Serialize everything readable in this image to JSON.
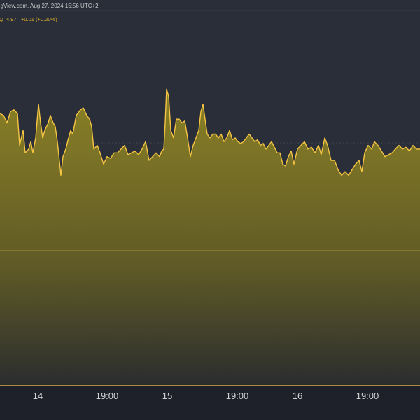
{
  "header": {
    "attribution": "ngView.com, Aug 27, 2024 15:56 UTC+2",
    "symbol_suffix": "Q",
    "last_price": "4.97",
    "change": "+0.01 (+0.20%)"
  },
  "colors": {
    "background": "#2a2e39",
    "axis_band": "#1e212a",
    "line": "#f5c542",
    "fill_top": "#8b8126",
    "fill_bottom": "#2b2d2e",
    "grid": "#41444f",
    "baseline": "#b9a53a"
  },
  "chart_data": {
    "type": "area",
    "title": "",
    "xlabel": "",
    "ylabel": "",
    "x_tick_labels": [
      "14",
      "19:00",
      "15",
      "19:00",
      "16",
      "19:00"
    ],
    "x_range": [
      0,
      600
    ],
    "y_range": [
      0,
      100
    ],
    "grid": true,
    "series": [
      {
        "values": [
          [
            0,
            72.5
          ],
          [
            5,
            72
          ],
          [
            10,
            70
          ],
          [
            15,
            73
          ],
          [
            20,
            73.5
          ],
          [
            25,
            72.5
          ],
          [
            28,
            64
          ],
          [
            33,
            68
          ],
          [
            36,
            62
          ],
          [
            41,
            63
          ],
          [
            44,
            65
          ],
          [
            47,
            62
          ],
          [
            51,
            66
          ],
          [
            55,
            75
          ],
          [
            58,
            70
          ],
          [
            61,
            66
          ],
          [
            64,
            68
          ],
          [
            69,
            70
          ],
          [
            72,
            72
          ],
          [
            76,
            70
          ],
          [
            79,
            69
          ],
          [
            82,
            65
          ],
          [
            87,
            56
          ],
          [
            90,
            61
          ],
          [
            94,
            63
          ],
          [
            98,
            66
          ],
          [
            101,
            68
          ],
          [
            104,
            67
          ],
          [
            109,
            72
          ],
          [
            115,
            73.5
          ],
          [
            119,
            74
          ],
          [
            124,
            72
          ],
          [
            128,
            71
          ],
          [
            131,
            69
          ],
          [
            134,
            63
          ],
          [
            139,
            64
          ],
          [
            143,
            62
          ],
          [
            148,
            59
          ],
          [
            153,
            61
          ],
          [
            158,
            60.5
          ],
          [
            163,
            62
          ],
          [
            168,
            62
          ],
          [
            173,
            63
          ],
          [
            178,
            64
          ],
          [
            183,
            61.5
          ],
          [
            188,
            62
          ],
          [
            193,
            62.5
          ],
          [
            198,
            61.5
          ],
          [
            203,
            63
          ],
          [
            208,
            65
          ],
          [
            213,
            60
          ],
          [
            218,
            61
          ],
          [
            223,
            62
          ],
          [
            228,
            61
          ],
          [
            231,
            62.5
          ],
          [
            234,
            63
          ],
          [
            236,
            70
          ],
          [
            238,
            79
          ],
          [
            241,
            77
          ],
          [
            244,
            68
          ],
          [
            248,
            66
          ],
          [
            252,
            71
          ],
          [
            256,
            71
          ],
          [
            260,
            70
          ],
          [
            264,
            70.5
          ],
          [
            268,
            66
          ],
          [
            272,
            61
          ],
          [
            276,
            64
          ],
          [
            280,
            66
          ],
          [
            284,
            68
          ],
          [
            287,
            73
          ],
          [
            290,
            75
          ],
          [
            293,
            71
          ],
          [
            296,
            67
          ],
          [
            300,
            66
          ],
          [
            304,
            67
          ],
          [
            308,
            67
          ],
          [
            312,
            66
          ],
          [
            316,
            67
          ],
          [
            320,
            65
          ],
          [
            324,
            66
          ],
          [
            328,
            68
          ],
          [
            332,
            65.5
          ],
          [
            336,
            66
          ],
          [
            340,
            65
          ],
          [
            344,
            64.5
          ],
          [
            348,
            65
          ],
          [
            352,
            66
          ],
          [
            356,
            67
          ],
          [
            360,
            66
          ],
          [
            364,
            65
          ],
          [
            368,
            65.5
          ],
          [
            372,
            64
          ],
          [
            376,
            64.5
          ],
          [
            380,
            63
          ],
          [
            384,
            64
          ],
          [
            388,
            65
          ],
          [
            392,
            63.5
          ],
          [
            396,
            62
          ],
          [
            400,
            62
          ],
          [
            404,
            59
          ],
          [
            408,
            58.5
          ],
          [
            412,
            61
          ],
          [
            416,
            62.5
          ],
          [
            420,
            59
          ],
          [
            425,
            63
          ],
          [
            430,
            64
          ],
          [
            435,
            65
          ],
          [
            440,
            63
          ],
          [
            445,
            63.5
          ],
          [
            450,
            62
          ],
          [
            455,
            64
          ],
          [
            459,
            61.5
          ],
          [
            464,
            66
          ],
          [
            468,
            64
          ],
          [
            473,
            60
          ],
          [
            478,
            60
          ],
          [
            483,
            57.5
          ],
          [
            488,
            56
          ],
          [
            493,
            57
          ],
          [
            498,
            56
          ],
          [
            503,
            57.5
          ],
          [
            508,
            59
          ],
          [
            513,
            60
          ],
          [
            517,
            57
          ],
          [
            521,
            62
          ],
          [
            526,
            64
          ],
          [
            531,
            63
          ],
          [
            535,
            65
          ],
          [
            540,
            64
          ],
          [
            545,
            62.5
          ],
          [
            550,
            61
          ],
          [
            555,
            61.5
          ],
          [
            560,
            62
          ],
          [
            565,
            63
          ],
          [
            570,
            64
          ],
          [
            575,
            63
          ],
          [
            580,
            63.5
          ],
          [
            585,
            62.5
          ],
          [
            590,
            64
          ],
          [
            595,
            63
          ],
          [
            600,
            63
          ]
        ]
      }
    ]
  }
}
